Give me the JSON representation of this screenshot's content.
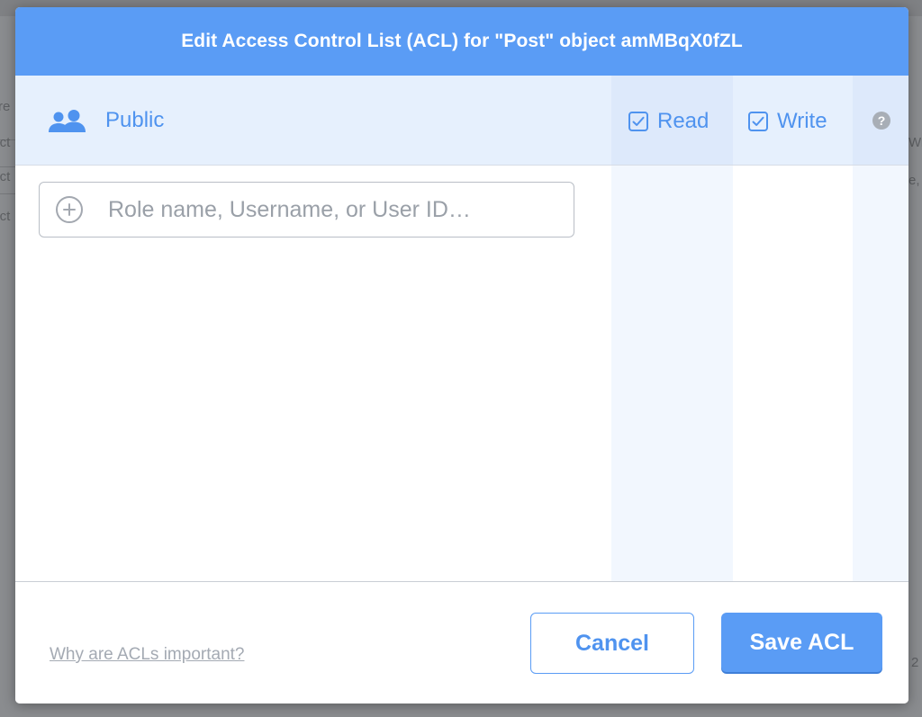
{
  "background": {
    "fragments": [
      "re",
      "Oct",
      "Oct",
      "Oct",
      "Wri",
      "e,",
      "2"
    ]
  },
  "modal": {
    "title": "Edit Access Control List (ACL) for \"Post\" object amMBqX0fZL",
    "public_row": {
      "label": "Public",
      "icon": "users-icon",
      "read_label": "Read",
      "read_checked": true,
      "write_label": "Write",
      "write_checked": true,
      "help_glyph": "?"
    },
    "add_field": {
      "placeholder": "Role name, Username, or User ID…",
      "value": "",
      "icon": "plus-circle-icon"
    },
    "footer": {
      "help_link": "Why are ACLs important?",
      "cancel_label": "Cancel",
      "save_label": "Save ACL"
    }
  },
  "colors": {
    "accent": "#5a9cf5",
    "row_tint": "#e6f0fd",
    "link_muted": "#a4aab3"
  }
}
